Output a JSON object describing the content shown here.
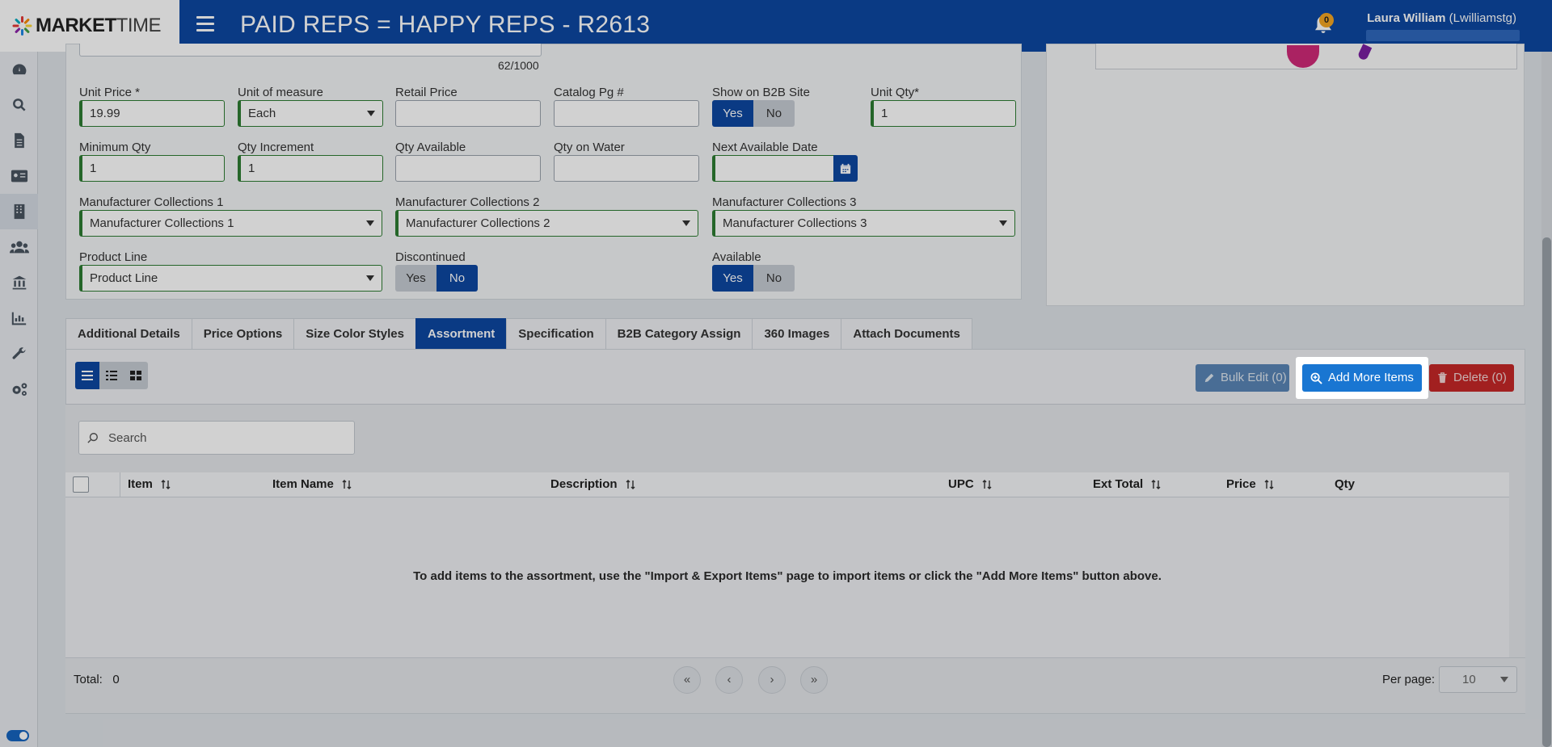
{
  "header": {
    "logo_bold": "MARKET",
    "logo_light": "TIME",
    "title": "PAID REPS = HAPPY REPS - R2613",
    "notification_count": "0",
    "user_name": "Laura William",
    "user_login": "(Lwilliamstg)"
  },
  "form": {
    "char_count": "62/1000",
    "unit_price": {
      "label": "Unit Price *",
      "value": "19.99"
    },
    "unit_of_measure": {
      "label": "Unit of measure",
      "value": "Each"
    },
    "retail_price": {
      "label": "Retail Price",
      "value": ""
    },
    "catalog_pg": {
      "label": "Catalog Pg #",
      "value": ""
    },
    "show_on_b2b": {
      "label": "Show on B2B Site",
      "yes": "Yes",
      "no": "No",
      "selected": "Yes"
    },
    "unit_qty": {
      "label": "Unit Qty*",
      "value": "1"
    },
    "minimum_qty": {
      "label": "Minimum Qty",
      "value": "1"
    },
    "qty_increment": {
      "label": "Qty Increment",
      "value": "1"
    },
    "qty_available": {
      "label": "Qty Available",
      "value": ""
    },
    "qty_on_water": {
      "label": "Qty on Water",
      "value": ""
    },
    "next_available_date": {
      "label": "Next Available Date",
      "value": ""
    },
    "mfr_collections_1": {
      "label": "Manufacturer Collections 1",
      "value": "Manufacturer Collections 1"
    },
    "mfr_collections_2": {
      "label": "Manufacturer Collections 2",
      "value": "Manufacturer Collections 2"
    },
    "mfr_collections_3": {
      "label": "Manufacturer Collections 3",
      "value": "Manufacturer Collections 3"
    },
    "product_line": {
      "label": "Product Line",
      "value": "Product Line"
    },
    "discontinued": {
      "label": "Discontinued",
      "yes": "Yes",
      "no": "No",
      "selected": "No"
    },
    "available": {
      "label": "Available",
      "yes": "Yes",
      "no": "No",
      "selected": "Yes"
    }
  },
  "tabs": [
    {
      "label": "Additional Details",
      "active": false
    },
    {
      "label": "Price Options",
      "active": false
    },
    {
      "label": "Size Color Styles",
      "active": false
    },
    {
      "label": "Assortment",
      "active": true
    },
    {
      "label": "Specification",
      "active": false
    },
    {
      "label": "B2B Category Assign",
      "active": false
    },
    {
      "label": "360 Images",
      "active": false
    },
    {
      "label": "Attach Documents",
      "active": false
    }
  ],
  "assortment": {
    "bulk_edit_label": "Bulk Edit (0)",
    "add_more_items_label": "Add More Items",
    "delete_label": "Delete (0)",
    "search_placeholder": "Search",
    "columns": [
      "Item",
      "Item Name",
      "Description",
      "UPC",
      "Ext Total",
      "Price",
      "Qty"
    ],
    "empty_message": "To add items to the assortment, use the \"Import & Export Items\" page to import items or click the \"Add More Items\" button above.",
    "total_label": "Total:",
    "total_value": "0",
    "pager": {
      "first": "«",
      "prev": "‹",
      "next": "›",
      "last": "»"
    },
    "per_page_label": "Per page:",
    "per_page_value": "10"
  },
  "colors": {
    "brand_blue": "#0d47a1",
    "action_blue": "#1976d2",
    "danger_red": "#c62828",
    "field_green": "#2e7d32"
  }
}
